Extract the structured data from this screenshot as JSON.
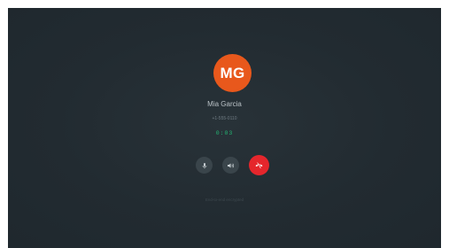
{
  "caller": {
    "initials": "MG",
    "avatar_color": "#e8581c",
    "name": "Mia Garcia",
    "number": "+1-555-0110",
    "duration": "0:03"
  },
  "controls": {
    "mute_icon": "microphone-icon",
    "speaker_icon": "speaker-icon",
    "end_icon": "hang-up-icon",
    "end_color": "#e5262c"
  },
  "footer": {
    "hint": "End-to-end encrypted"
  }
}
